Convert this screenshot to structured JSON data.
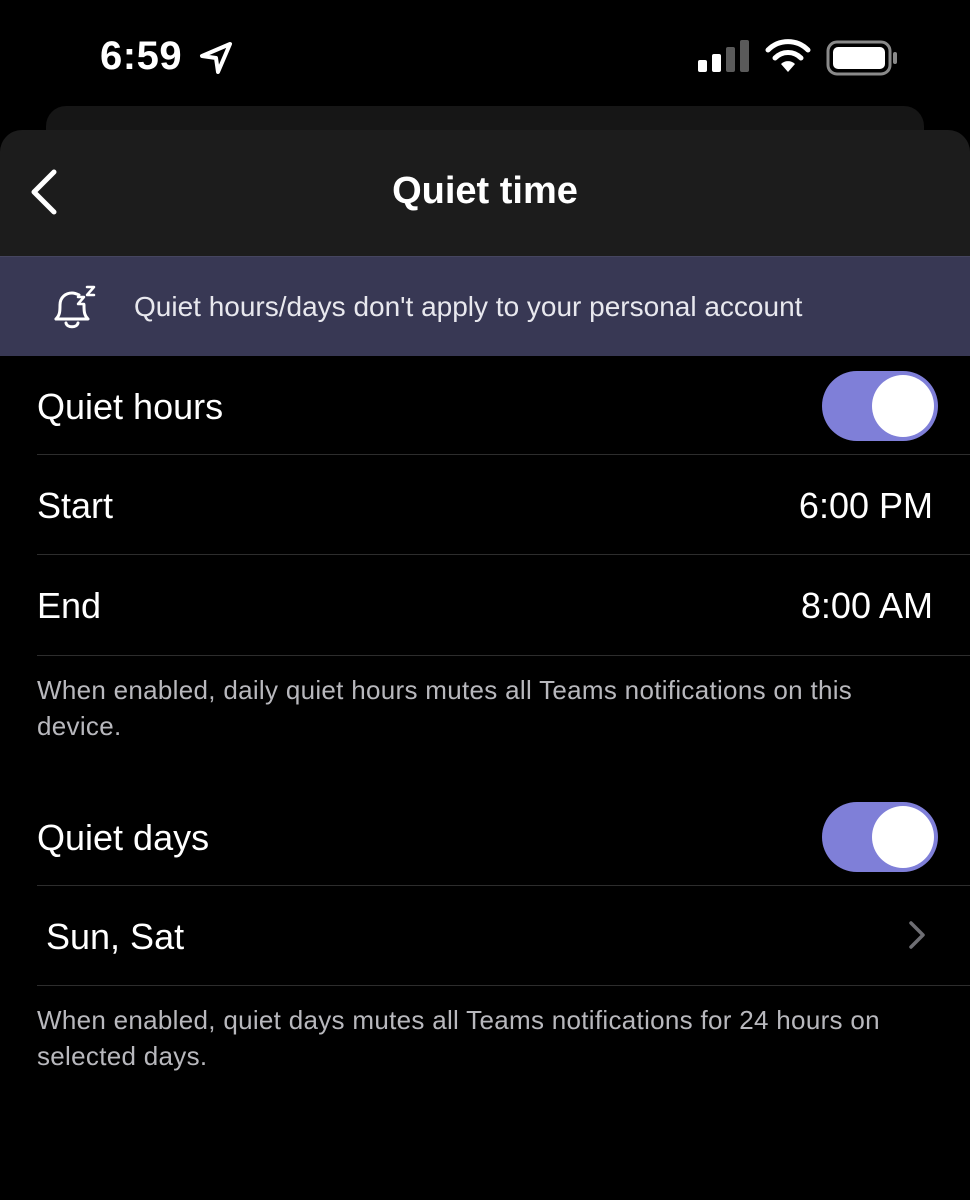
{
  "status_bar": {
    "time": "6:59",
    "icons": [
      "location-arrow-icon",
      "cellular-signal-icon",
      "wifi-icon",
      "battery-icon"
    ]
  },
  "header": {
    "title": "Quiet time",
    "back_icon": "chevron-left-icon"
  },
  "banner": {
    "icon": "snooze-bell-icon",
    "text": "Quiet hours/days don't apply to your personal account"
  },
  "quiet_hours": {
    "label": "Quiet hours",
    "enabled": true,
    "start_label": "Start",
    "start_value": "6:00 PM",
    "end_label": "End",
    "end_value": "8:00 AM",
    "help_text": "When enabled, daily quiet hours mutes all Teams notifications on this device."
  },
  "quiet_days": {
    "label": "Quiet days",
    "enabled": true,
    "days_value": "Sun, Sat",
    "help_text": "When enabled, quiet days mutes all Teams notifications for 24 hours on selected days."
  },
  "colors": {
    "background": "#000000",
    "header": "#1c1c1c",
    "banner": "#383854",
    "toggle_on": "#7f7fd8",
    "secondary_text": "#b8b8bd"
  }
}
